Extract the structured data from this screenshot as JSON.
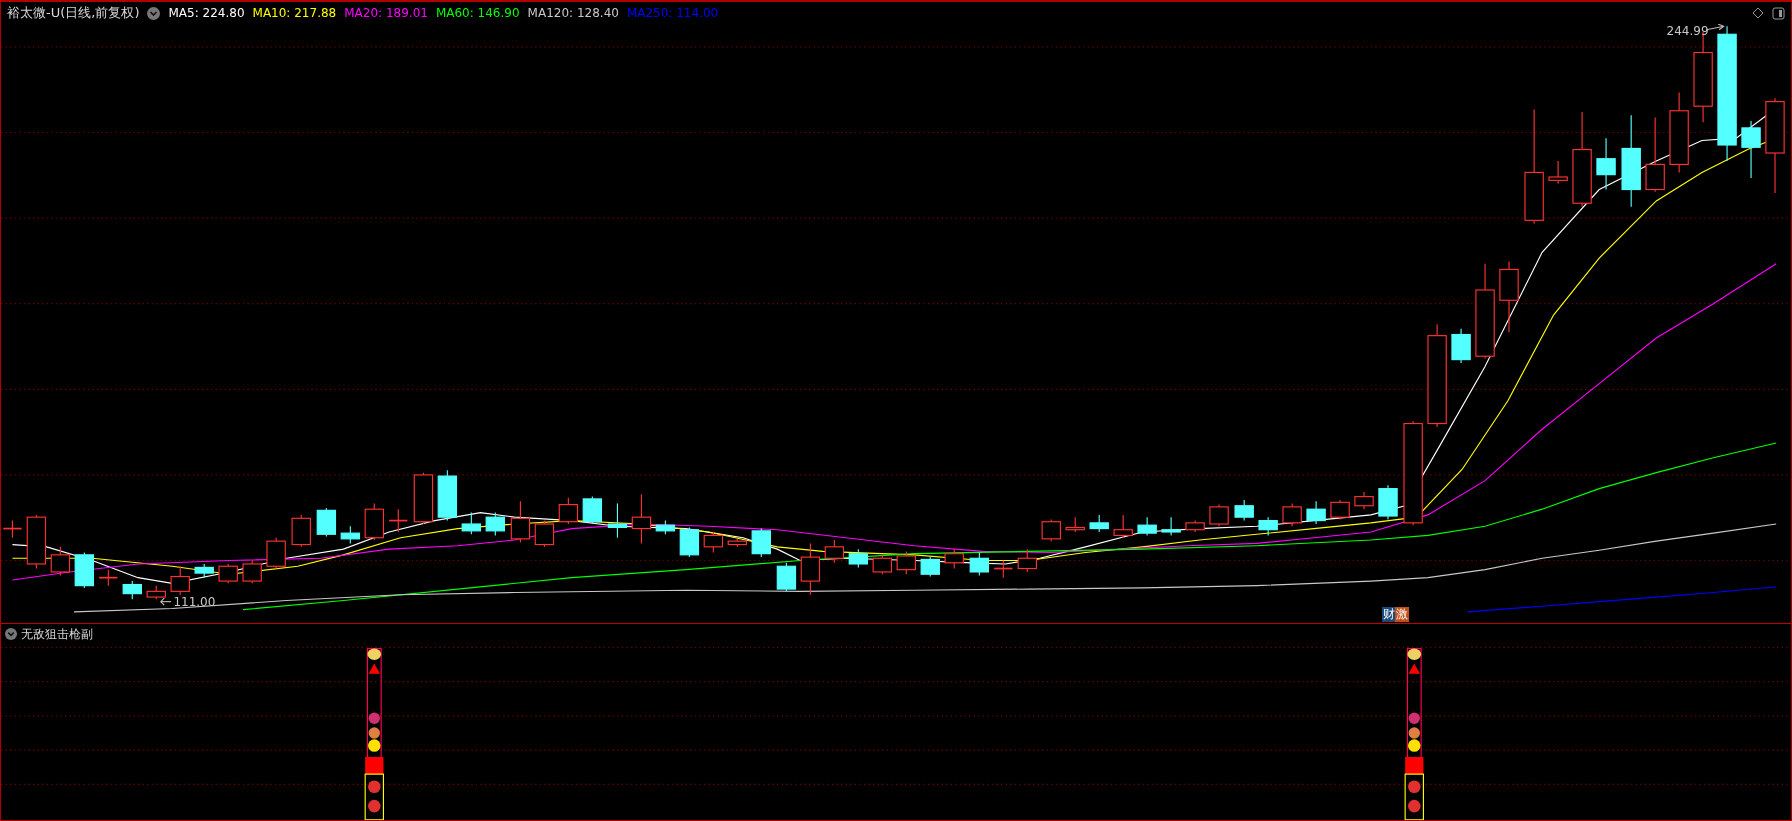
{
  "window": {
    "title": "裕太微-U(日线,前复权)"
  },
  "legend": [
    {
      "label": "MA5: 224.80",
      "color": "#ffffff"
    },
    {
      "label": "MA10: 217.88",
      "color": "#ffff00"
    },
    {
      "label": "MA20: 189.01",
      "color": "#ff00ff"
    },
    {
      "label": "MA60: 146.90",
      "color": "#00ff00"
    },
    {
      "label": "MA120: 128.40",
      "color": "#c8c8c8"
    },
    {
      "label": "MA250: 114.00",
      "color": "#0000ff"
    }
  ],
  "chart_labels": {
    "high": "244.99",
    "low": "111.00"
  },
  "badges": [
    {
      "text": "财",
      "color": "#1a4a7a"
    },
    {
      "text": "激",
      "color": "#c0501a"
    }
  ],
  "indicator": {
    "title": "无敌狙击枪副"
  }
}
